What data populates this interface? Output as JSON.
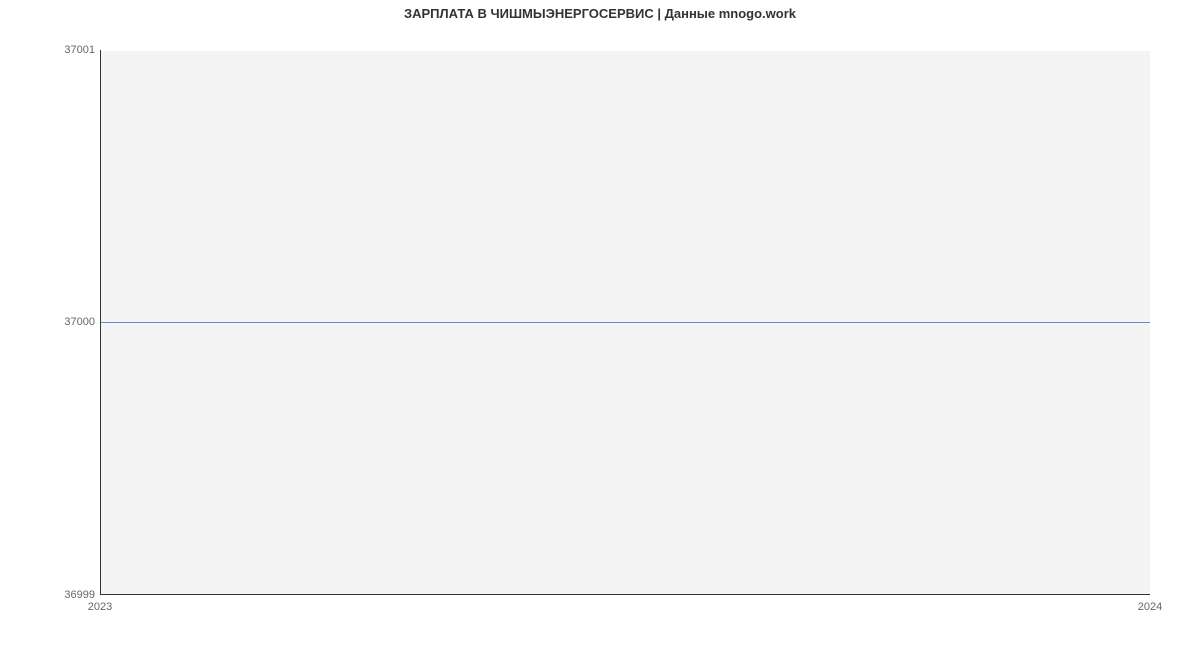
{
  "chart_data": {
    "type": "line",
    "title": "ЗАРПЛАТА В ЧИШМЫЭНЕРГОСЕРВИС | Данные mnogo.work",
    "xlabel": "",
    "ylabel": "",
    "x": [
      2023,
      2024
    ],
    "values": [
      37000,
      37000
    ],
    "x_ticks": [
      "2023",
      "2024"
    ],
    "y_ticks": [
      "36999",
      "37000",
      "37001"
    ],
    "xlim": [
      2023,
      2024
    ],
    "ylim": [
      36999,
      37001
    ]
  }
}
